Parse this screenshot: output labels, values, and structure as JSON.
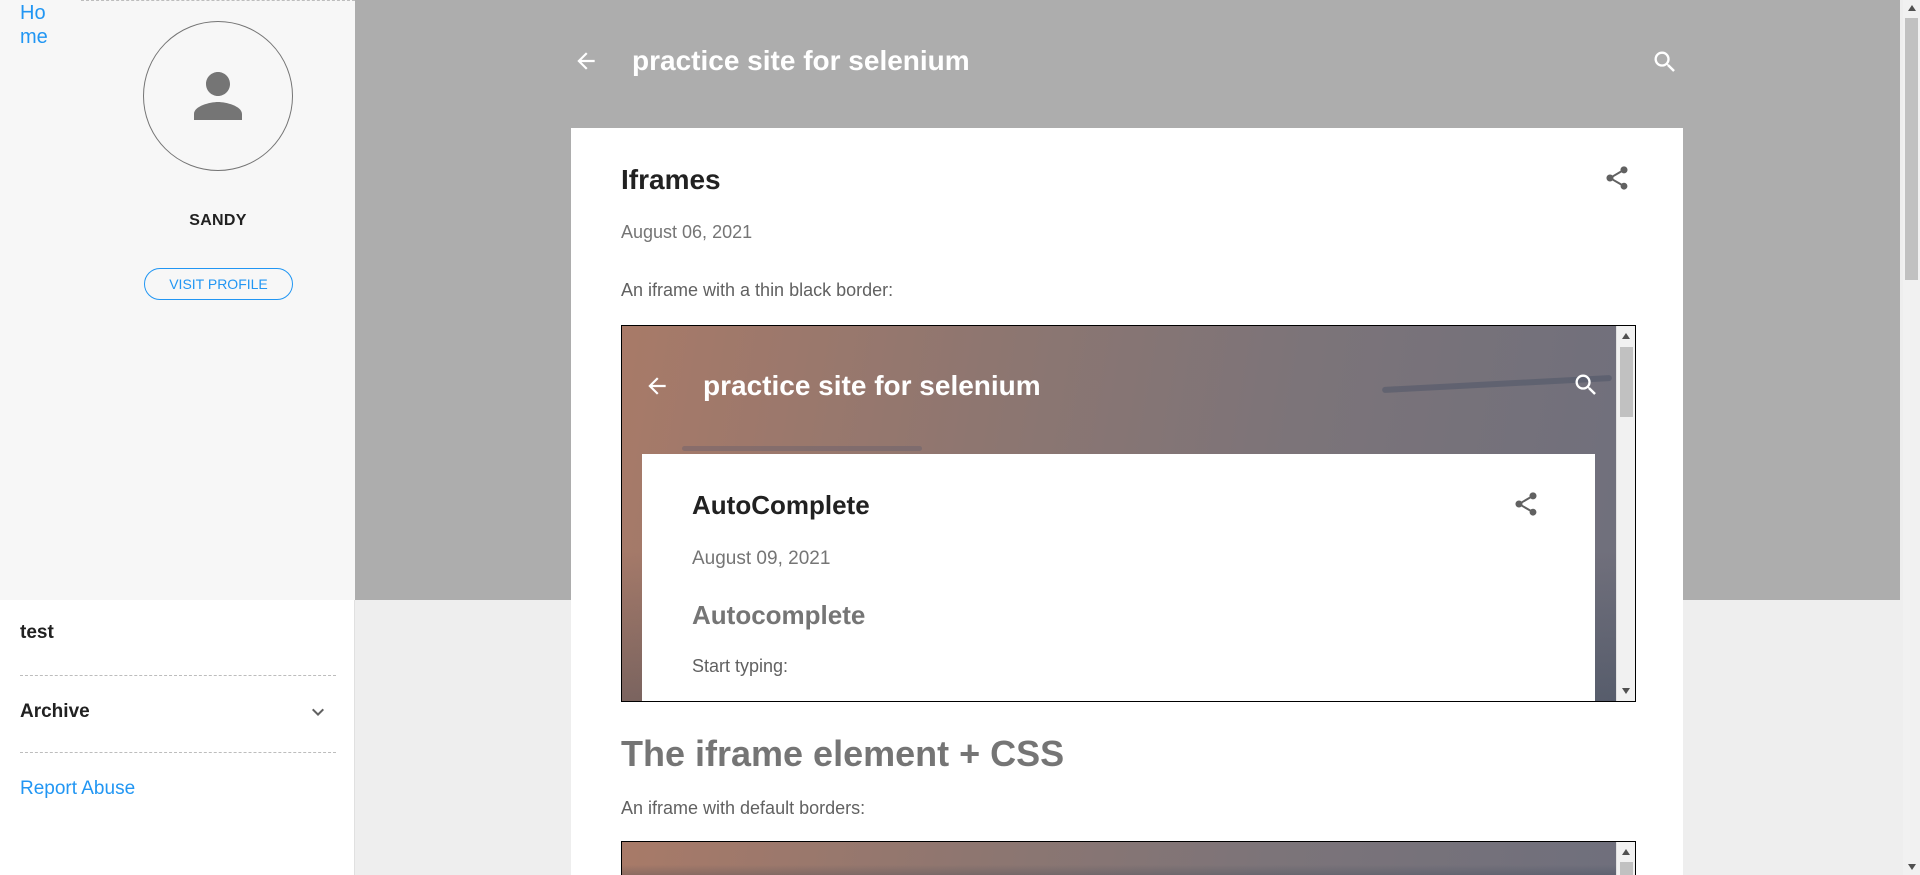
{
  "sidebar": {
    "home_link": "Home",
    "profile_name": "SANDY",
    "visit_profile_label": "VISIT PROFILE",
    "sections": {
      "test_label": "test",
      "archive_label": "Archive"
    },
    "report_abuse_label": "Report Abuse"
  },
  "header": {
    "site_title": "practice site for selenium"
  },
  "post": {
    "title": "Iframes",
    "date": "August 06, 2021",
    "paragraph1": "An iframe with a thin black border:",
    "heading2": "The iframe element + CSS",
    "paragraph2": "An iframe with default borders:"
  },
  "embedded_iframe": {
    "site_title": "practice site for selenium",
    "post_title": "AutoComplete",
    "post_date": "August 09, 2021",
    "heading": "Autocomplete",
    "text": "Start typing:"
  },
  "icons": {
    "back": "arrow-back-icon",
    "search": "search-icon",
    "share": "share-icon",
    "avatar": "person-icon",
    "archive_toggle": "chevron-down-icon"
  },
  "colors": {
    "accent": "#2196f3",
    "header_band": "#adadad",
    "page_bg": "#eeeeee",
    "sidebar_top": "#f7f7f7"
  }
}
